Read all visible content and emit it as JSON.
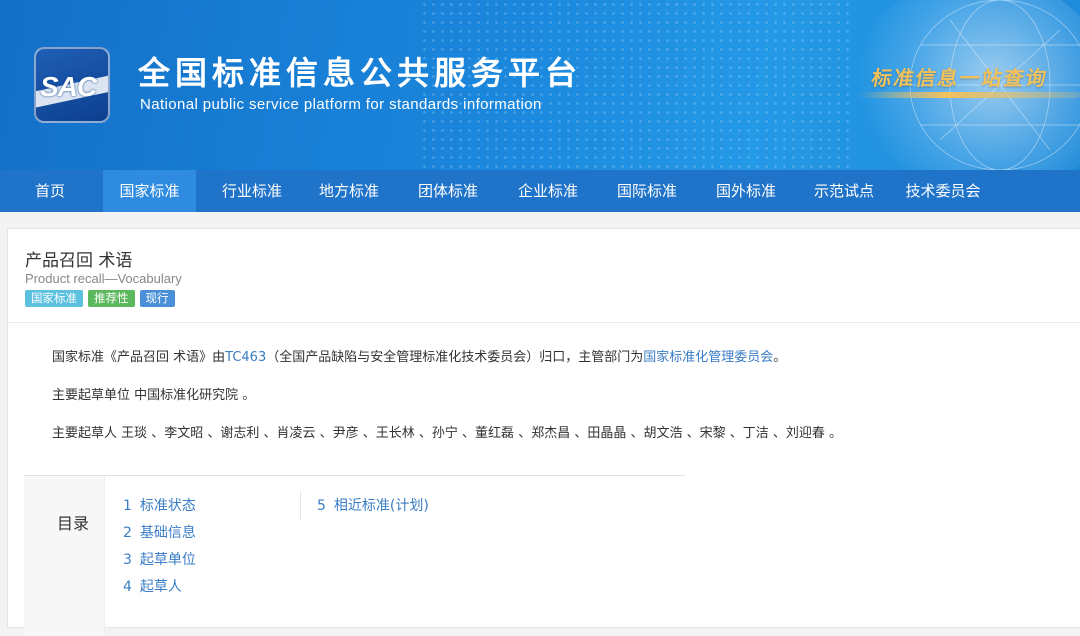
{
  "header": {
    "logo_text": "SAC",
    "title_cn": "全国标准信息公共服务平台",
    "title_en": "National public service platform  for standards information",
    "slogan": "标准信息一站查询"
  },
  "nav": {
    "items": [
      "首页",
      "国家标准",
      "行业标准",
      "地方标准",
      "团体标准",
      "企业标准",
      "国际标准",
      "国外标准",
      "示范试点",
      "技术委员会"
    ],
    "active_index": 1
  },
  "standard": {
    "title_cn": "产品召回 术语",
    "title_en": "Product recall—Vocabulary",
    "tags": [
      "国家标准",
      "推荐性",
      "现行"
    ],
    "desc_prefix": "国家标准《产品召回 术语》由",
    "tc_link": "TC463",
    "desc_middle": "（全国产品缺陷与安全管理标准化技术委员会）归口，主管部门为",
    "dept_link": "国家标准化管理委员会",
    "desc_suffix": "。",
    "drafting_unit_line": "主要起草单位 中国标准化研究院 。",
    "drafters_line": "主要起草人 王琰 、李文昭 、谢志利 、肖凌云 、尹彦 、王长林 、孙宁 、董红磊 、郑杰昌 、田晶晶 、胡文浩 、宋黎 、丁洁 、刘迎春 。"
  },
  "toc": {
    "label": "目录",
    "items": [
      {
        "num": "1",
        "label": "标准状态"
      },
      {
        "num": "2",
        "label": "基础信息"
      },
      {
        "num": "3",
        "label": "起草单位"
      },
      {
        "num": "4",
        "label": "起草人"
      },
      {
        "num": "5",
        "label": "相近标准(计划)"
      }
    ]
  },
  "colors": {
    "nav_bg": "#1f73c9",
    "nav_active": "#2e8be0",
    "link": "#3a7dc6",
    "slogan": "#f3c15a"
  }
}
